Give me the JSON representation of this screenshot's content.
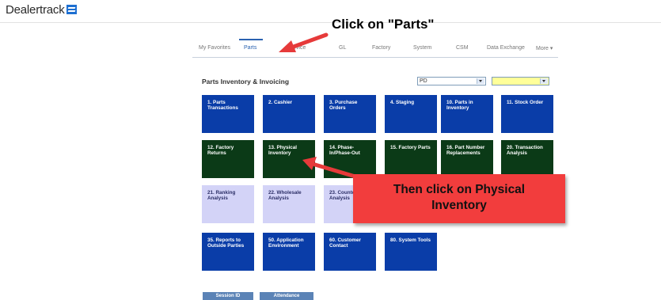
{
  "brand": {
    "name": "Dealertrack"
  },
  "nav": {
    "tabs": [
      {
        "label": "My Favorites",
        "active": false
      },
      {
        "label": "Parts",
        "active": true
      },
      {
        "label": "Service",
        "active": false
      },
      {
        "label": "GL",
        "active": false
      },
      {
        "label": "Factory",
        "active": false
      },
      {
        "label": "System",
        "active": false
      },
      {
        "label": "CSM",
        "active": false
      },
      {
        "label": "Data Exchange",
        "active": false
      },
      {
        "label": "More ▾",
        "active": false
      }
    ]
  },
  "section": {
    "title": "Parts Inventory & Invoicing",
    "select_1_value": "PD",
    "select_2_value": ""
  },
  "tiles": [
    {
      "label": "1. Parts Transactions",
      "color": "blue"
    },
    {
      "label": "2. Cashier",
      "color": "blue"
    },
    {
      "label": "3. Purchase Orders",
      "color": "blue"
    },
    {
      "label": "4. Staging",
      "color": "blue"
    },
    {
      "label": "10. Parts in Inventory",
      "color": "blue"
    },
    {
      "label": "11. Stock Order",
      "color": "blue"
    },
    {
      "label": "12. Factory Returns",
      "color": "green"
    },
    {
      "label": "13. Physical Inventory",
      "color": "green"
    },
    {
      "label": "14. Phase-In/Phase-Out",
      "color": "green"
    },
    {
      "label": "15. Factory Parts",
      "color": "green"
    },
    {
      "label": "16. Part Number Replacements",
      "color": "green"
    },
    {
      "label": "20. Transaction Analysis",
      "color": "green"
    },
    {
      "label": "21. Ranking Analysis",
      "color": "lavender"
    },
    {
      "label": "22. Wholesale Analysis",
      "color": "lavender"
    },
    {
      "label": "23. Counter Analysis",
      "color": "lavender"
    },
    {
      "label": "35. Reports to Outside Parties",
      "color": "blue"
    },
    {
      "label": "50. Application Environment",
      "color": "blue"
    },
    {
      "label": "60. Customer Contact",
      "color": "blue"
    },
    {
      "label": "80. System Tools",
      "color": "blue"
    }
  ],
  "bottom_buttons": [
    {
      "label": "Session ID"
    },
    {
      "label": "Attendance"
    }
  ],
  "annotations": {
    "click_parts": "Click on \"Parts\"",
    "click_physical_line1": "Then click on Physical",
    "click_physical_line2": "Inventory"
  },
  "colors": {
    "tile_blue": "#0a3da8",
    "tile_green": "#0b3a17",
    "tile_lavender": "#d3d3f7",
    "callout_red": "#f23d3d",
    "select_yellow": "#ffff99",
    "nav_active": "#2a62b0"
  }
}
